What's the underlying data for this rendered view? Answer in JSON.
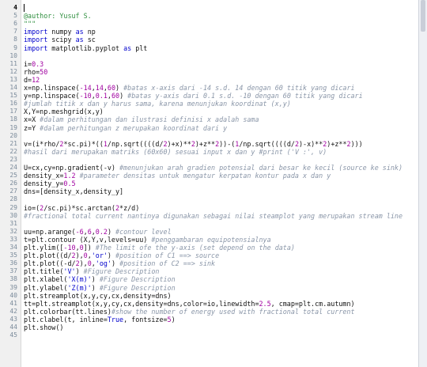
{
  "editor": {
    "current_line": "4",
    "lines": [
      {
        "n": "4",
        "html": ""
      },
      {
        "n": "5",
        "html": "<span class='docs'>@author: Yusuf S.</span>"
      },
      {
        "n": "6",
        "html": "<span class='docs'>\"\"\"</span>"
      },
      {
        "n": "7",
        "html": "<span class='kw'>import</span> numpy <span class='kw'>as</span> np"
      },
      {
        "n": "8",
        "html": "<span class='kw'>import</span> scipy <span class='kw'>as</span> sc"
      },
      {
        "n": "9",
        "html": "<span class='kw'>import</span> matplotlib.pyplot <span class='kw'>as</span> plt"
      },
      {
        "n": "10",
        "html": ""
      },
      {
        "n": "11",
        "html": "i=<span class='num'>0.3</span>"
      },
      {
        "n": "12",
        "html": "rho=<span class='num'>50</span>"
      },
      {
        "n": "13",
        "html": "d=<span class='num'>12</span>"
      },
      {
        "n": "14",
        "html": "x=np.linspace(<span class='num'>-14</span>,<span class='num'>14</span>,<span class='num'>60</span>) <span class='cm'>#batas x-axis dari -14 s.d. 14 dengan 60 titik yang dicari</span>"
      },
      {
        "n": "15",
        "html": "y=np.linspace(<span class='num'>-10</span>,<span class='num'>0.1</span>,<span class='num'>60</span>) <span class='cm'>#batas y-axis dari 0.1 s.d. -10 dengan 60 titik yang dicari</span>"
      },
      {
        "n": "16",
        "html": "<span class='cm'>#jumlah titik x dan y harus sama, karena menunjukan koordinat (x,y)</span>"
      },
      {
        "n": "17",
        "html": "X,Y=np.meshgrid(x,y)"
      },
      {
        "n": "18",
        "html": "x=X <span class='cm'>#dalam perhitungan dan ilustrasi definisi x adalah sama</span>"
      },
      {
        "n": "19",
        "html": "z=Y <span class='cm'>#dalam perhitungan z merupakan koordinat dari y</span>"
      },
      {
        "n": "20",
        "html": ""
      },
      {
        "n": "21",
        "html": "v=(i*rho/<span class='num'>2</span>*sc.pi)*((<span class='num'>1</span>/np.sqrt((((d/<span class='num'>2</span>)+x)**<span class='num'>2</span>)+z**<span class='num'>2</span>))-(<span class='num'>1</span>/np.sqrt((((d/<span class='num'>2</span>)-x)**<span class='num'>2</span>)+z**<span class='num'>2</span>)))"
      },
      {
        "n": "22",
        "html": "<span class='cm'>#hasil dari merupakan matriks (60x60) sesuai input x dan y #print ('V :', v)</span>"
      },
      {
        "n": "23",
        "html": ""
      },
      {
        "n": "24",
        "html": "U=cx,cy=np.gradient(-v) <span class='cm'>#menunjukan arah gradien potensial dari besar ke kecil (source ke sink)</span>"
      },
      {
        "n": "25",
        "html": "density_x=<span class='num'>1.2</span> <span class='cm'>#parameter densitas untuk mengatur kerpatan kontur pada x dan y</span>"
      },
      {
        "n": "26",
        "html": "density_y=<span class='num'>0.5</span>"
      },
      {
        "n": "27",
        "html": "dns=[density_x,density_y]"
      },
      {
        "n": "28",
        "html": ""
      },
      {
        "n": "29",
        "html": "io=(<span class='num'>2</span>/sc.pi)*sc.arctan(<span class='num'>2</span>*z/d)"
      },
      {
        "n": "30",
        "html": "<span class='cm'>#fractional total current nantinya digunakan sebagai nilai steamplot yang merupakan stream line</span>"
      },
      {
        "n": "31",
        "html": ""
      },
      {
        "n": "32",
        "html": "uu=np.arange(<span class='num'>-6</span>,<span class='num'>6</span>,<span class='num'>0.2</span>) <span class='cm'>#contour level</span>"
      },
      {
        "n": "33",
        "html": "t=plt.contour (X,Y,v,levels=uu) <span class='cm'>#penggambaran equipotensialnya</span>"
      },
      {
        "n": "34",
        "html": "plt.ylim([<span class='num'>-10</span>,<span class='num'>0</span>]) <span class='cm'>#The limit ofe the y-axis (set depend on the data)</span>"
      },
      {
        "n": "35",
        "html": "plt.plot((d/<span class='num'>2</span>),<span class='num'>0</span>,<span class='str'>'or'</span>) <span class='cm'>#position of C1 ==&gt; source</span>"
      },
      {
        "n": "36",
        "html": "plt.plot((-d/<span class='num'>2</span>),<span class='num'>0</span>,<span class='str'>'og'</span>) <span class='cm'>#position of C2 ==&gt; sink</span>"
      },
      {
        "n": "37",
        "html": "plt.title(<span class='str'>'V'</span>) <span class='cm'>#Figure Description</span>"
      },
      {
        "n": "38",
        "html": "plt.xlabel(<span class='str'>'X(m)'</span>) <span class='cm'>#Figure Description</span>"
      },
      {
        "n": "39",
        "html": "plt.ylabel(<span class='str'>'Z(m)'</span>) <span class='cm'>#Figure Description</span>"
      },
      {
        "n": "40",
        "html": "plt.streamplot(x,y,cy,cx,density=dns)"
      },
      {
        "n": "41",
        "html": "tt=plt.streamplot(x,y,cy,cx,density=dns,color=io,linewidth=<span class='num'>2.5</span>, cmap=plt.cm.autumn)"
      },
      {
        "n": "42",
        "html": "plt.colorbar(tt.lines)<span class='cm'>#show the number of energy used with fractional total current</span>"
      },
      {
        "n": "43",
        "html": "plt.clabel(t, inline=<span class='kw'>True</span>, fontsize=<span class='num'>5</span>)"
      },
      {
        "n": "44",
        "html": "plt.show()"
      },
      {
        "n": "45",
        "html": ""
      }
    ]
  }
}
